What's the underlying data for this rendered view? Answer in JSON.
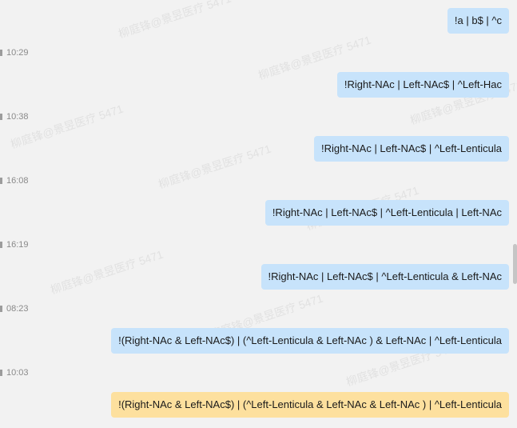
{
  "watermark": "柳庭锋@景昱医疗 5471",
  "messages": [
    {
      "text": "!a | b$ | ^c"
    },
    {
      "time": "10:29",
      "text": "!Right-NAc | Left-NAc$ | ^Left-Hac"
    },
    {
      "time": "10:38",
      "text": "!Right-NAc | Left-NAc$ | ^Left-Lenticula"
    },
    {
      "time": "16:08",
      "text": "!Right-NAc | Left-NAc$ | ^Left-Lenticula | Left-NAc"
    },
    {
      "time": "16:19",
      "text": "!Right-NAc | Left-NAc$ | ^Left-Lenticula & Left-NAc"
    },
    {
      "time": "08:23",
      "text": "!(Right-NAc & Left-NAc$) | (^Left-Lenticula & Left-NAc ) & Left-NAc | ^Left-Lenticula"
    },
    {
      "time": "10:03",
      "text": "!(Right-NAc & Left-NAc$) | (^Left-Lenticula & Left-NAc & Left-NAc )  | ^Left-Lenticula"
    }
  ]
}
